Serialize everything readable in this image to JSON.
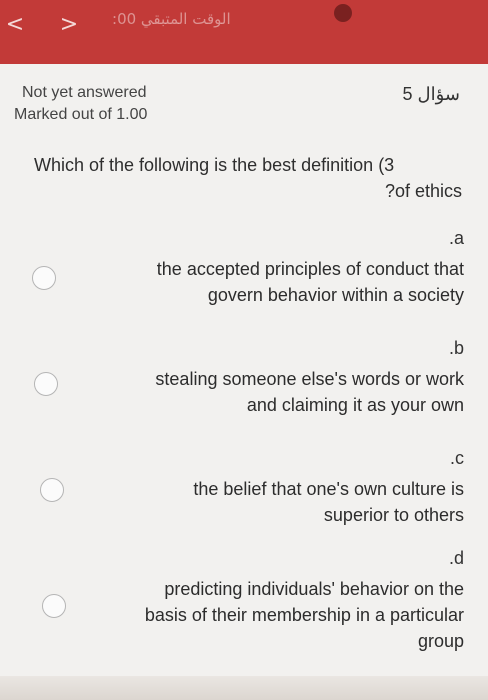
{
  "topbar": {
    "back_icon": "chevron-left-icon",
    "forward_icon": "chevron-right-icon",
    "timer_text": "الوقت المتبقي 00:",
    "accent": "#c23a38"
  },
  "status": {
    "answered": "Not yet answered",
    "marked": "Marked out of 1.00"
  },
  "question": {
    "number_label": "سؤال 5",
    "text_line1": "Which of the following is the best definition (3",
    "text_line2": "?of ethics"
  },
  "options": [
    {
      "letter": ".a",
      "line1": "the accepted principles of conduct that",
      "line2": "govern behavior within a society",
      "line3": ""
    },
    {
      "letter": ".b",
      "line1": "stealing someone else's words or work",
      "line2": "and claiming it as your own",
      "line3": ""
    },
    {
      "letter": ".c",
      "line1": "the belief that one's own culture is",
      "line2": "superior to others",
      "line3": ""
    },
    {
      "letter": ".d",
      "line1": "predicting individuals' behavior on the",
      "line2": "basis of their membership in a particular",
      "line3": "group"
    }
  ]
}
